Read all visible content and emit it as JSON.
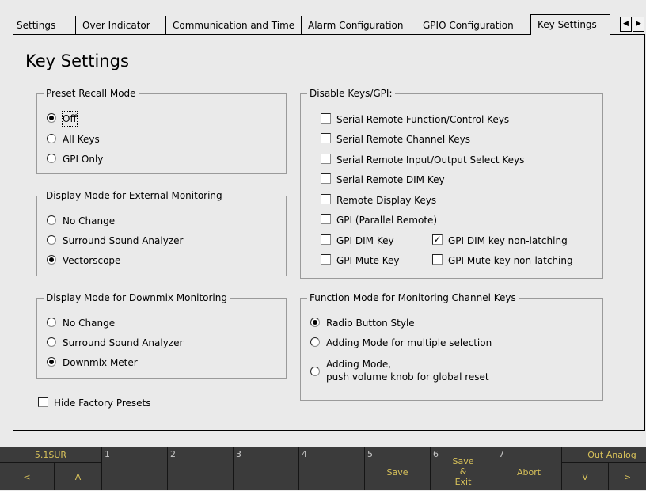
{
  "tabs": {
    "settings": "Settings",
    "over_indicator": "Over Indicator",
    "communication": "Communication and Time",
    "alarm": "Alarm Configuration",
    "gpio": "GPIO Configuration",
    "key_settings": "Key Settings",
    "active": "Key Settings"
  },
  "page_title": "Key Settings",
  "preset_recall": {
    "legend": "Preset Recall Mode",
    "options": [
      "Off",
      "All Keys",
      "GPI Only"
    ],
    "selected": "Off"
  },
  "ext_monitoring": {
    "legend": "Display Mode for External Monitoring",
    "options": [
      "No Change",
      "Surround Sound Analyzer",
      "Vectorscope"
    ],
    "selected": "Vectorscope"
  },
  "downmix_monitoring": {
    "legend": "Display Mode for Downmix Monitoring",
    "options": [
      "No Change",
      "Surround Sound Analyzer",
      "Downmix Meter"
    ],
    "selected": "Downmix Meter"
  },
  "hide_factory_presets": {
    "label": "Hide Factory Presets",
    "checked": false
  },
  "disable_keys": {
    "legend": "Disable Keys/GPI:",
    "items": [
      {
        "label": "Serial Remote Function/Control Keys",
        "checked": false
      },
      {
        "label": "Serial Remote Channel Keys",
        "checked": false
      },
      {
        "label": "Serial Remote Input/Output Select Keys",
        "checked": false
      },
      {
        "label": "Serial Remote DIM Key",
        "checked": false
      },
      {
        "label": "Remote Display Keys",
        "checked": false
      },
      {
        "label": "GPI (Parallel Remote)",
        "checked": false
      },
      {
        "label": "GPI DIM Key",
        "checked": false
      },
      {
        "label": "GPI DIM key non-latching",
        "checked": true
      },
      {
        "label": "GPI Mute Key",
        "checked": false
      },
      {
        "label": "GPI Mute key non-latching",
        "checked": false
      }
    ]
  },
  "function_mode": {
    "legend": "Function Mode for Monitoring Channel Keys",
    "options": [
      "Radio Button Style",
      "Adding Mode for multiple selection",
      "Adding Mode,",
      "push volume knob for global reset"
    ],
    "selected": "Radio Button Style"
  },
  "footer": {
    "left_label": "5.1SUR",
    "left_prev": "<",
    "left_up": "Λ",
    "keys": [
      {
        "num": "1",
        "label": ""
      },
      {
        "num": "2",
        "label": ""
      },
      {
        "num": "3",
        "label": ""
      },
      {
        "num": "4",
        "label": ""
      },
      {
        "num": "5",
        "label": "Save"
      },
      {
        "num": "6",
        "label1": "Save",
        "label2": "&",
        "label3": "Exit"
      },
      {
        "num": "7",
        "label": "Abort"
      }
    ],
    "right_label": "Out Analog",
    "right_down": "V",
    "right_next": ">"
  },
  "icons": {
    "left": "◀",
    "right": "▶",
    "check": "✓"
  },
  "colors": {
    "background": "#eaeaea",
    "footer_bg": "#3b3b3b",
    "footer_text": "#d8c25a"
  }
}
